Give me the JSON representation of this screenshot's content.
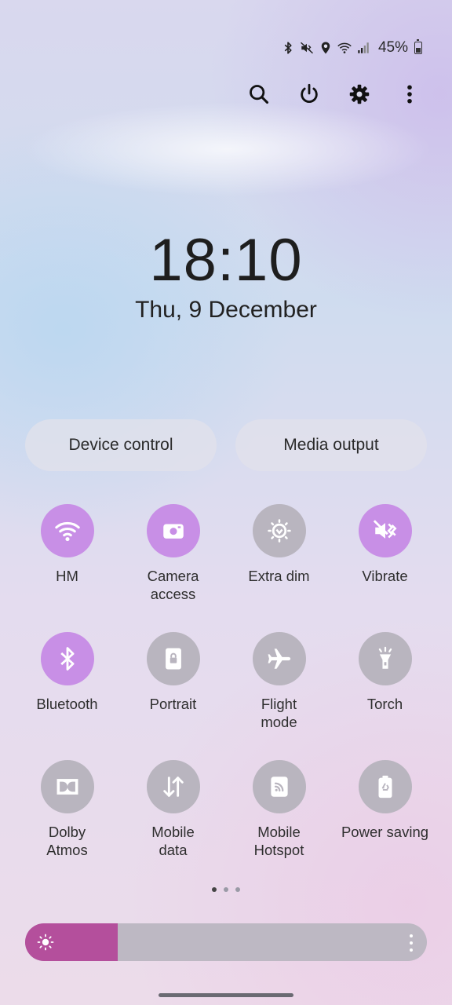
{
  "status_bar": {
    "battery_percent": "45%",
    "battery_level": 0.45,
    "icons": [
      "bluetooth-icon",
      "mute-vibrate-icon",
      "location-icon",
      "wifi-icon",
      "signal-icon",
      "battery-icon"
    ]
  },
  "top_actions": [
    "search-icon",
    "power-icon",
    "settings-icon",
    "more-vert-icon"
  ],
  "clock": {
    "time": "18:10",
    "date": "Thu, 9 December"
  },
  "pills": {
    "device_control": "Device control",
    "media_output": "Media output"
  },
  "tiles": [
    {
      "label": "HM",
      "state": "on",
      "icon": "wifi-icon"
    },
    {
      "label": "Camera\naccess",
      "state": "on",
      "icon": "camera-icon"
    },
    {
      "label": "Extra dim",
      "state": "off",
      "icon": "extra-dim-icon"
    },
    {
      "label": "Vibrate",
      "state": "on",
      "icon": "vibrate-icon"
    },
    {
      "label": "Bluetooth",
      "state": "on",
      "icon": "bluetooth-icon"
    },
    {
      "label": "Portrait",
      "state": "off",
      "icon": "portrait-lock-icon"
    },
    {
      "label": "Flight\nmode",
      "state": "off",
      "icon": "airplane-icon"
    },
    {
      "label": "Torch",
      "state": "off",
      "icon": "torch-icon"
    },
    {
      "label": "Dolby\nAtmos",
      "state": "off",
      "icon": "dolby-icon"
    },
    {
      "label": "Mobile\ndata",
      "state": "off",
      "icon": "mobile-data-icon"
    },
    {
      "label": "Mobile\nHotspot",
      "state": "off",
      "icon": "hotspot-icon"
    },
    {
      "label": "Power saving",
      "state": "off",
      "icon": "power-saving-icon"
    }
  ],
  "page_indicator": {
    "count": 3,
    "active": 0
  },
  "brightness": {
    "level": 0.23,
    "icon": "sun-icon"
  },
  "colors": {
    "tile_on": "#c88fe6",
    "tile_off": "#b9b5bf",
    "brightness_fill": "#b44f9c"
  }
}
